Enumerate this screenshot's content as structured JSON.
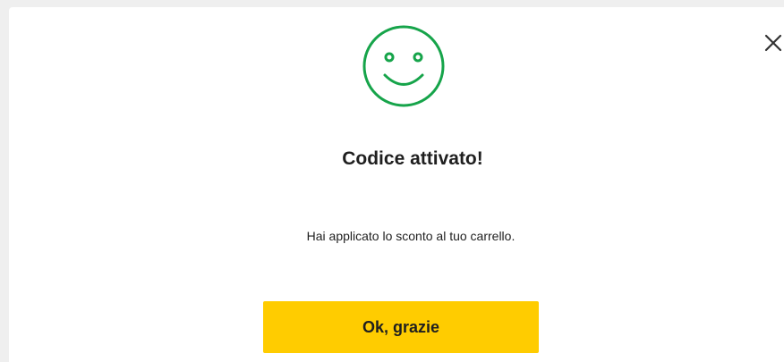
{
  "dialog": {
    "title": "Codice attivato!",
    "message": "Hai applicato lo sconto al tuo carrello.",
    "confirm_label": "Ok, grazie",
    "close_icon": "close-icon",
    "status_icon": "smiley-face-icon"
  },
  "colors": {
    "accent_green": "#16a44a",
    "button_yellow": "#ffcc00",
    "text_dark": "#1f1f1f",
    "backdrop": "#efefef",
    "surface": "#ffffff"
  }
}
